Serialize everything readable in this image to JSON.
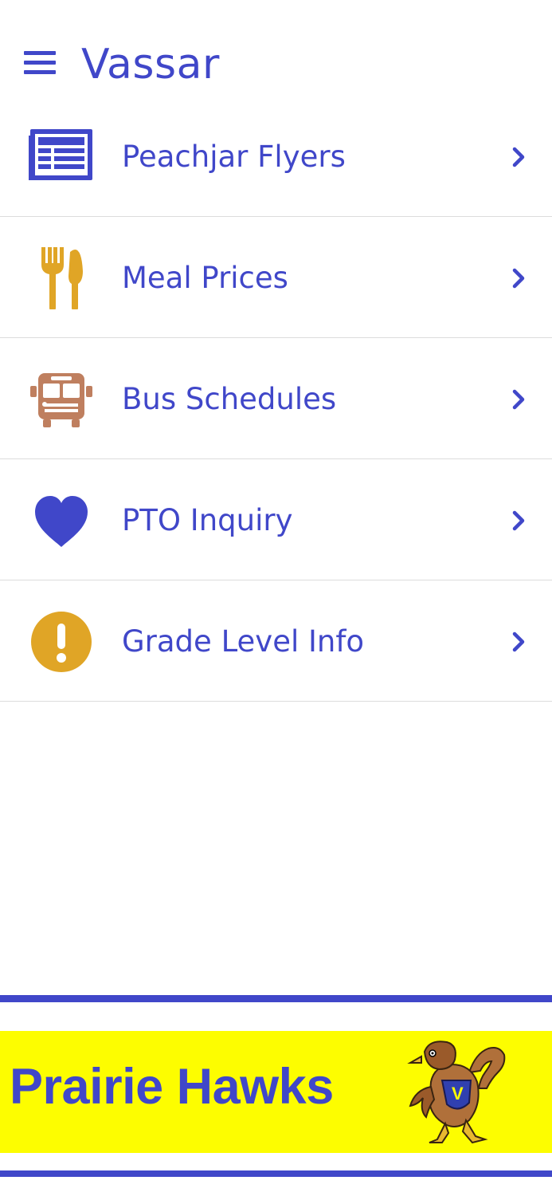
{
  "header": {
    "title": "Vassar",
    "menu_icon": "hamburger-menu-icon"
  },
  "colors": {
    "accent": "#4047c9",
    "gold": "#e0a526",
    "bus_brown": "#bf7f5f",
    "banner_yellow": "#fdfd00",
    "divider": "#dcdcdc"
  },
  "menu": {
    "items": [
      {
        "label": "Peachjar Flyers",
        "icon": "newspaper-icon"
      },
      {
        "label": "Meal Prices",
        "icon": "fork-knife-icon"
      },
      {
        "label": "Bus Schedules",
        "icon": "bus-icon"
      },
      {
        "label": "PTO Inquiry",
        "icon": "heart-icon"
      },
      {
        "label": "Grade Level Info",
        "icon": "exclamation-circle-icon"
      }
    ]
  },
  "banner": {
    "text": "Prairie Hawks",
    "mascot": "hawk-mascot-logo"
  }
}
